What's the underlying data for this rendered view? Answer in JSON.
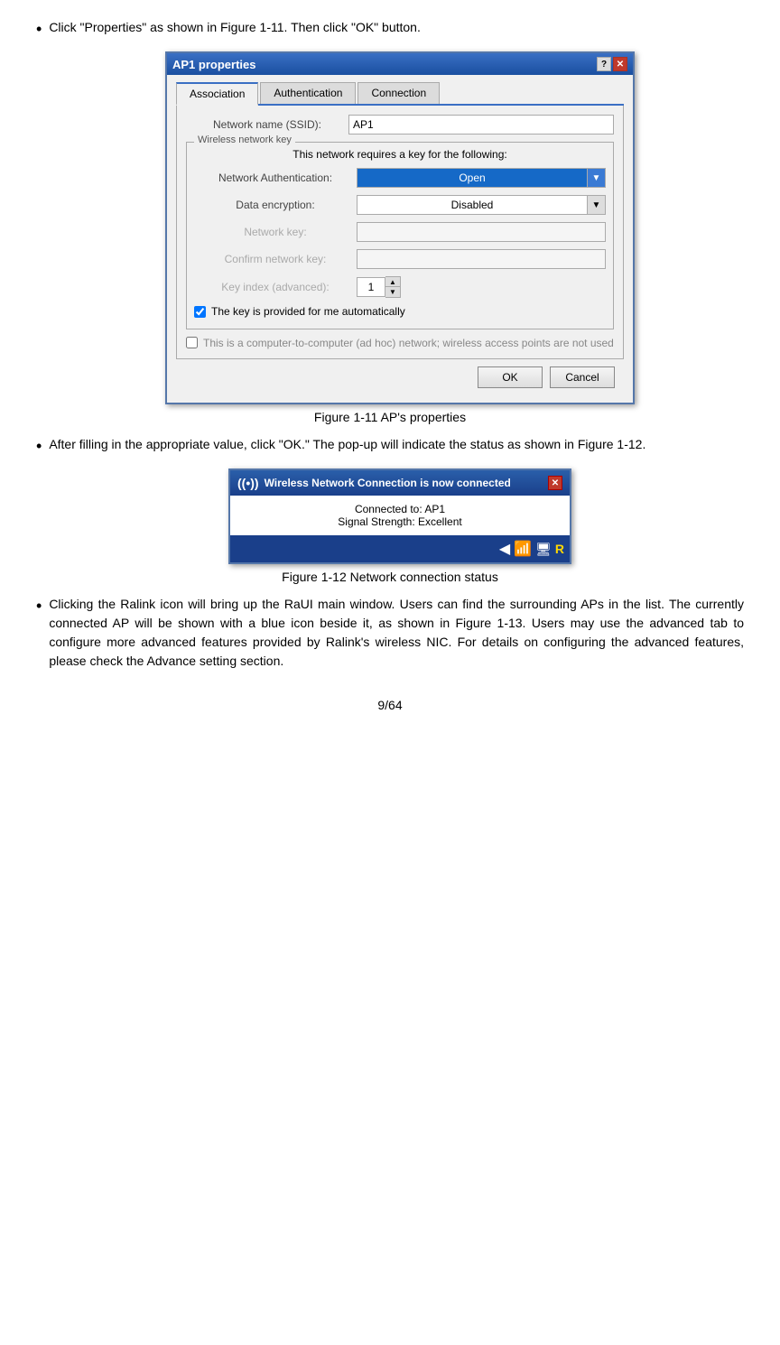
{
  "bullet1": {
    "text": "Click \"Properties\" as shown in Figure 1-11. Then click \"OK\" button."
  },
  "dialog": {
    "title": "AP1 properties",
    "tabs": [
      {
        "label": "Association",
        "active": true
      },
      {
        "label": "Authentication",
        "active": false
      },
      {
        "label": "Connection",
        "active": false
      }
    ],
    "network_name_label": "Network name (SSID):",
    "network_name_value": "AP1",
    "group_box_title": "Wireless network key",
    "group_box_desc": "This network requires a key for the following:",
    "network_auth_label": "Network Authentication:",
    "network_auth_value": "Open",
    "data_enc_label": "Data encryption:",
    "data_enc_value": "Disabled",
    "network_key_label": "Network key:",
    "network_key_value": "",
    "confirm_key_label": "Confirm network key:",
    "confirm_key_value": "",
    "key_index_label": "Key index (advanced):",
    "key_index_value": "1",
    "checkbox1_label": "The key is provided for me automatically",
    "checkbox1_checked": true,
    "ad_hoc_label": "This is a computer-to-computer (ad hoc) network; wireless access points are not used",
    "ad_hoc_checked": false,
    "ok_label": "OK",
    "cancel_label": "Cancel"
  },
  "figure1_caption": "Figure 1-11 AP's properties",
  "bullet2": {
    "text": "After filling in the appropriate value, click \"OK.\" The pop-up will indicate the status as shown in Figure 1-12."
  },
  "popup": {
    "header": "Wireless Network Connection is now connected",
    "connected_to": "Connected to: AP1",
    "signal": "Signal Strength: Excellent"
  },
  "figure2_caption": "Figure 1-12 Network connection status",
  "bullet3": {
    "text": "Clicking the Ralink icon will bring up the RaUI main window. Users can find the surrounding APs in the list. The currently connected AP will be shown with a blue icon beside it, as shown in Figure 1-13. Users may use the advanced tab to configure more advanced features provided by Ralink's wireless NIC. For details on configuring the advanced features, please check the Advance setting section."
  },
  "page_number": "9/64"
}
